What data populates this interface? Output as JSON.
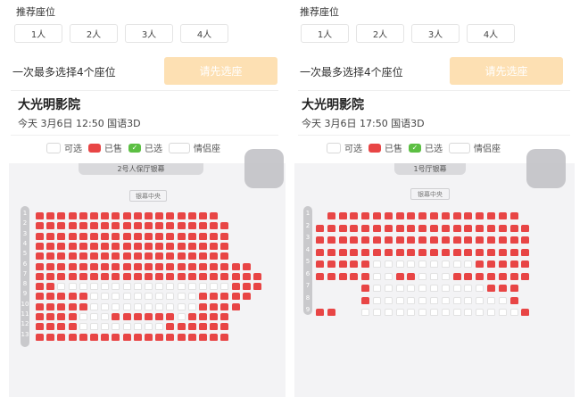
{
  "left": {
    "section_title": "推荐座位",
    "people_buttons": [
      "1人",
      "2人",
      "3人",
      "4人"
    ],
    "max_text": "一次最多选择4个座位",
    "cta_label": "请先选座",
    "cinema_name": "大光明影院",
    "showtime": "今天 3月6日 12:50 国语3D",
    "legend": {
      "available": "可选",
      "sold": "已售",
      "selected": "已选",
      "couple": "情侣座"
    },
    "screen_label": "2号人保厅银幕",
    "center_label": "银幕中央",
    "rows": [
      "1",
      "2",
      "3",
      "4",
      "5",
      "6",
      "7",
      "8",
      "9",
      "10",
      "11",
      "12",
      "13"
    ]
  },
  "right": {
    "section_title": "推荐座位",
    "people_buttons": [
      "1人",
      "2人",
      "3人",
      "4人"
    ],
    "max_text": "一次最多选择4个座位",
    "cta_label": "请先选座",
    "cinema_name": "大光明影院",
    "showtime": "今天 3月6日 17:50 国语3D",
    "legend": {
      "available": "可选",
      "sold": "已售",
      "selected": "已选",
      "couple": "情侣座"
    },
    "screen_label": "1号厅银幕",
    "center_label": "银幕中央",
    "rows": [
      "1",
      "2",
      "3",
      "4",
      "5",
      "6",
      "7",
      "8",
      "9"
    ]
  },
  "colors": {
    "sold": "#e84545",
    "available": "#ffffff",
    "selected": "#5cbf43",
    "cta": "#fde0b3"
  },
  "seat_maps": {
    "left": [
      "SSSSSSSSSSSSSSSSS",
      "SSSSSSSSSSSSSSSSSS",
      "SSSSSSSSSSSSSSSSSS",
      "SSSSSSSSSSSSSSSSSS",
      "SSSSSSSSSSSSSSSSSS",
      "SSSSSSSSSSSSSSSSSSSS",
      "SSSSSSSSSSSSSSSSSSSSS",
      "SSAAAAAAAAAAAAAAAASSS",
      "SSSSSAAAAAAAAAASSSSS",
      "SSSSSAAAAAAAAAASSSS",
      "SSSSAAASSSSSSASSSS",
      "SSSSAAAAAAAASSSSSS",
      "SSSSSSSSSSSSSSSSSS"
    ],
    "right": [
      ".SSSSSSSSSSSSSSSSS",
      "SSSSSSSSSSSSSSSSSSS",
      "SSSSSSSSSSSSSSSSSSS",
      "SSSSSSSSSSSSSSSSSSS",
      "SSSSSAAAAAAAAASSSSS",
      "SSSSSAASSAAASSSSSSS",
      "....SAAAAAAAAAASSS",
      "....SAAAAAAAAAAAAS",
      "SS..AAAAAAAAAAAAAAS"
    ]
  }
}
